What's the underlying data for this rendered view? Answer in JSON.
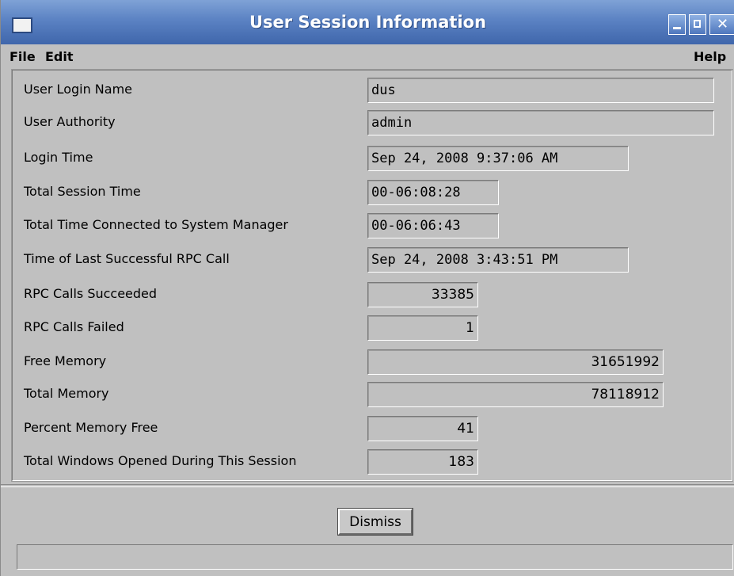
{
  "window": {
    "title": "User Session Information",
    "controls": [
      "minimize-icon",
      "maximize-icon",
      "close-icon"
    ]
  },
  "menu": {
    "file": "File",
    "edit": "Edit",
    "help": "Help"
  },
  "rows": [
    {
      "label": "User Login Name",
      "value": "dus"
    },
    {
      "label": "User Authority",
      "value": "admin"
    },
    {
      "label": "Login Time",
      "value": "Sep 24, 2008 9:37:06 AM"
    },
    {
      "label": "Total Session Time",
      "value": "00-06:08:28"
    },
    {
      "label": "Total Time Connected to System Manager",
      "value": "00-06:06:43"
    },
    {
      "label": "Time of Last Successful RPC Call",
      "value": "Sep 24, 2008 3:43:51 PM"
    },
    {
      "label": "RPC Calls Succeeded",
      "value": "33385"
    },
    {
      "label": "RPC Calls Failed",
      "value": "1"
    },
    {
      "label": "Free Memory",
      "value": "31651992"
    },
    {
      "label": "Total Memory",
      "value": "78118912"
    },
    {
      "label": "Percent Memory Free",
      "value": "41"
    },
    {
      "label": "Total Windows Opened During This Session",
      "value": "183"
    }
  ],
  "actions": {
    "dismiss": "Dismiss"
  },
  "status": {
    "text": ""
  },
  "colors": {
    "titlebar": "#5b82c3",
    "background": "#c0c0c0"
  }
}
